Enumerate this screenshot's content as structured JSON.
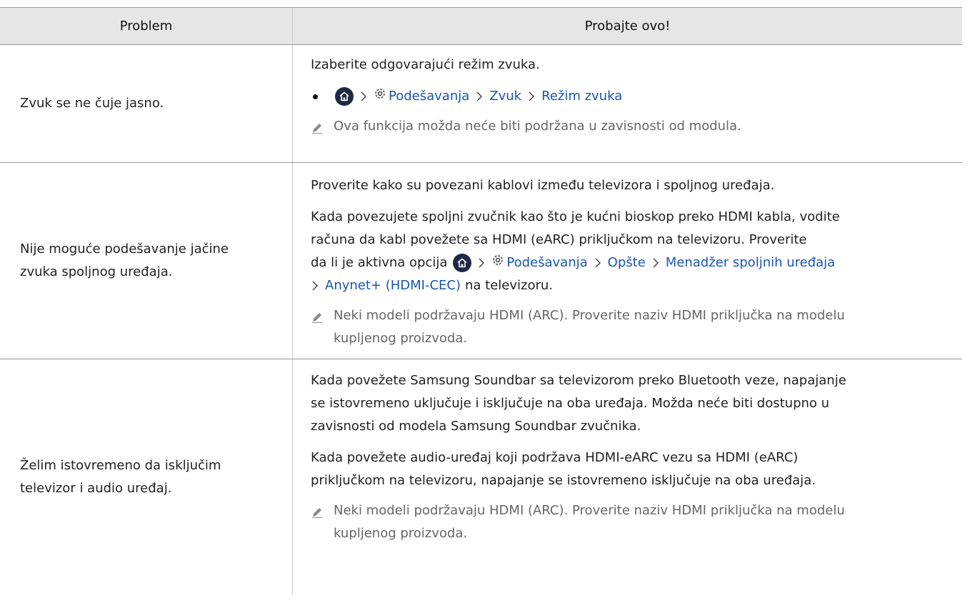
{
  "header": {
    "col1": "Problem",
    "col2": "Probajte ovo!"
  },
  "rows": [
    {
      "problem": "Zvuk se ne čuje jasno.",
      "p1": "Izaberite odgovarajući režim zvuka.",
      "path": [
        "Podešavanja",
        "Zvuk",
        "Režim zvuka"
      ],
      "note": "Ova funkcija možda neće biti podržana u zavisnosti od modula."
    },
    {
      "problem_l1": "Nije moguće podešavanje jačine",
      "problem_l2": "zvuka spoljnog uređaja.",
      "p1": "Proverite kako su povezani kablovi između televizora i spoljnog uređaja.",
      "p2_l1": "Kada povezujete spoljni zvučnik kao što je kućni bioskop preko HDMI kabla, vodite",
      "p2_l2": "računa da kabl povežete sa HDMI (eARC) priključkom na televizoru. Proverite",
      "p2_l3_pre": "da li je aktivna opcija",
      "path": [
        "Podešavanja",
        "Opšte",
        "Menadžer spoljnih uređaja",
        "Anynet+ (HDMI-CEC)"
      ],
      "p2_tail": "na televizoru.",
      "note_l1": "Neki modeli podržavaju HDMI (ARC). Proverite naziv HDMI priključka na modelu",
      "note_l2": "kupljenog proizvoda."
    },
    {
      "problem_l1": "Želim istovremeno da isključim",
      "problem_l2": "televizor i audio uređaj.",
      "p1_l1": "Kada povežete Samsung Soundbar sa televizorom preko Bluetooth veze, napajanje",
      "p1_l2": "se istovremeno uključuje i isključuje na oba uređaja. Možda neće biti dostupno u",
      "p1_l3": "zavisnosti od modela Samsung Soundbar zvučnika.",
      "p2_l1": "Kada povežete audio-uređaj koji podržava HDMI-eARC vezu sa HDMI (eARC)",
      "p2_l2": "priključkom na televizoru, napajanje se istovremeno isključuje na oba uređaja.",
      "note_l1": "Neki modeli podržavaju HDMI (ARC). Proverite naziv HDMI priključka na modelu",
      "note_l2": "kupljenog proizvoda."
    }
  ],
  "colors": {
    "link": "#1a56b0",
    "header_bg": "#e6e6e6",
    "home_btn": "#1d2a44"
  },
  "icons": [
    "home-icon",
    "gear-icon",
    "chevron-right-icon",
    "pencil-note-icon",
    "bullet-icon"
  ]
}
